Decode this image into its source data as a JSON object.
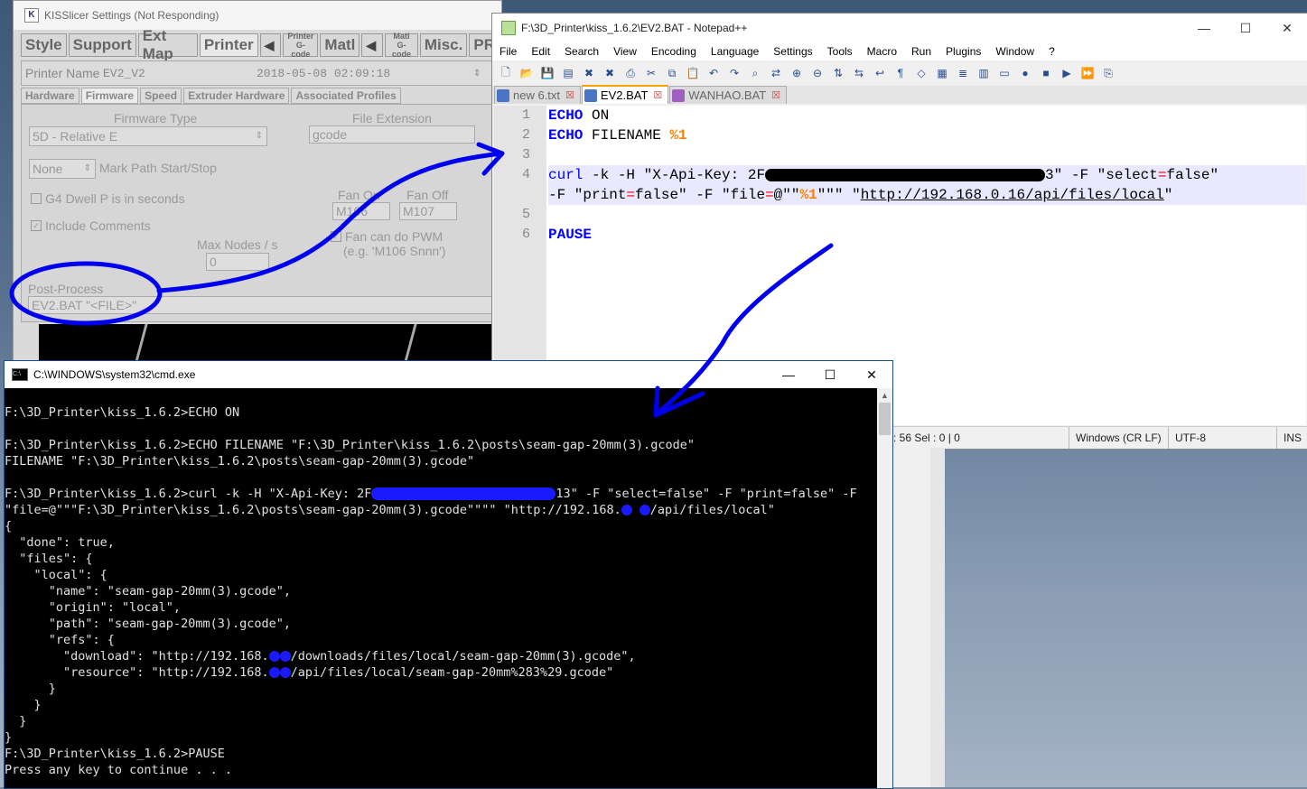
{
  "kisslicer": {
    "title": "KISSlicer Settings (Not Responding)",
    "tabs": [
      "Style",
      "Support",
      "Ext Map",
      "Printer"
    ],
    "small_tab_printer_gcode": [
      "Printer",
      "G-code"
    ],
    "tab_matl": "Matl",
    "small_tab_matl_gcode": [
      "Matl",
      "G-code"
    ],
    "tab_misc": "Misc.",
    "tab_pr": "PR",
    "printer_name_label": "Printer Name",
    "printer_name_value": "EV2_V2",
    "printer_date": "2018-05-08 02:09:18",
    "subtabs": [
      "Hardware",
      "Firmware",
      "Speed",
      "Extruder Hardware",
      "Associated Profiles"
    ],
    "firmware_type_label": "Firmware Type",
    "firmware_type_value": "5D - Relative E",
    "file_extension_label": "File Extension",
    "file_extension_value": "gcode",
    "mark_path_value": "None",
    "mark_path_label": "Mark Path Start/Stop",
    "g4_dwell_label": "G4 Dwell P is in seconds",
    "include_comments_label": "Include Comments",
    "fan_on_label": "Fan On",
    "fan_on_value": "M106",
    "fan_off_label": "Fan Off",
    "fan_off_value": "M107",
    "max_nodes_label": "Max Nodes / s",
    "max_nodes_value": "0",
    "fan_pwm_label": "Fan can do PWM",
    "fan_pwm_hint": "(e.g. 'M106 Snnn')",
    "post_process_label": "Post-Process",
    "post_process_value": "EV2.BAT \"<FILE>\""
  },
  "notepad": {
    "title": "F:\\3D_Printer\\kiss_1.6.2\\EV2.BAT - Notepad++",
    "menu": [
      "File",
      "Edit",
      "Search",
      "View",
      "Encoding",
      "Language",
      "Settings",
      "Tools",
      "Macro",
      "Run",
      "Plugins",
      "Window",
      "?"
    ],
    "file_tabs": [
      "new 6.txt",
      "EV2.BAT",
      "WANHAO.BAT"
    ],
    "line_numbers": [
      "1",
      "2",
      "3",
      "4",
      "",
      "5",
      "6"
    ],
    "code": {
      "l1_kw": "ECHO",
      "l1_rest": " ON",
      "l2_kw": "ECHO",
      "l2_rest": " FILENAME ",
      "l2_var": "%1",
      "l4_kw": "curl",
      "l4_a": " -k -H \"X-Api-Key: 2F",
      "l4_b": "3\" -F \"select",
      "l4_eq": "=",
      "l4_c": "false\"",
      "l5_a": "-F \"print",
      "l5_eq": "=",
      "l5_b": "false\" -F \"file",
      "l5_eq2": "=",
      "l5_c": "@\"\"",
      "l5_var": "%1",
      "l5_d": "\"\"\" \"",
      "l5_link": "http://192.168.0.16/api/files/local",
      "l5_e": "\"",
      "l6_kw": "PAUSE"
    },
    "status": {
      "pos": ": 56    Sel : 0 | 0",
      "eol": "Windows (CR LF)",
      "encoding": "UTF-8",
      "mode": "INS"
    }
  },
  "cmd": {
    "title": "C:\\WINDOWS\\system32\\cmd.exe",
    "lines": [
      "",
      "F:\\3D_Printer\\kiss_1.6.2>ECHO ON",
      "",
      "F:\\3D_Printer\\kiss_1.6.2>ECHO FILENAME \"F:\\3D_Printer\\kiss_1.6.2\\posts\\seam-gap-20mm(3).gcode\"",
      "FILENAME \"F:\\3D_Printer\\kiss_1.6.2\\posts\\seam-gap-20mm(3).gcode\"",
      ""
    ],
    "curl_a": "F:\\3D_Printer\\kiss_1.6.2>curl -k -H \"X-Api-Key: 2F",
    "curl_b": "13\" -F \"select=false\" -F \"print=false\" -F",
    "curl2_a": "\"file=@\"\"\"F:\\3D_Printer\\kiss_1.6.2\\posts\\seam-gap-20mm(3).gcode\"\"\"\" \"http://192.168.",
    "curl2_b": "/api/files/local\"",
    "json_lines": [
      "{",
      "  \"done\": true,",
      "  \"files\": {",
      "    \"local\": {",
      "      \"name\": \"seam-gap-20mm(3).gcode\",",
      "      \"origin\": \"local\",",
      "      \"path\": \"seam-gap-20mm(3).gcode\",",
      "      \"refs\": {"
    ],
    "download_a": "        \"download\": \"http://192.168.",
    "download_b": "/downloads/files/local/seam-gap-20mm(3).gcode\",",
    "resource_a": "        \"resource\": \"http://192.168.",
    "resource_b": "/api/files/local/seam-gap-20mm%283%29.gcode\"",
    "tail_lines": [
      "      }",
      "    }",
      "  }",
      "}",
      "F:\\3D_Printer\\kiss_1.6.2>PAUSE",
      "Press any key to continue . . ."
    ]
  },
  "colors": {
    "annotation": "#0000ee",
    "keyword": "#0000ff",
    "variable": "#ff8000"
  }
}
